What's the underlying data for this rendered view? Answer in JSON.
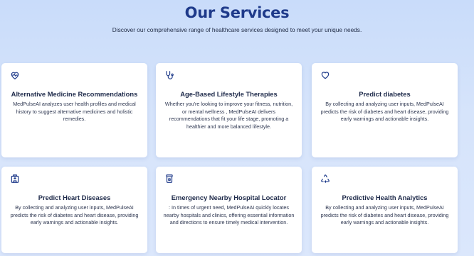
{
  "header": {
    "title": "Our Services",
    "subtitle": "Discover our comprehensive range of healthcare services designed to meet your unique needs."
  },
  "services": [
    {
      "icon": "heart-pulse-icon",
      "title": "Alternative Medicine Recommendations",
      "description": "MedPulseAI analyzes user health profiles and medical history to suggest alternative medicines and holistic remedies."
    },
    {
      "icon": "stethoscope-icon",
      "title": "Age-Based Lifestyle Therapies",
      "description": "Whether you're looking to improve your fitness, nutrition, or mental wellness , MedPulseAI delivers recommendations that fit your life stage, promoting a healthier and more balanced lifestyle."
    },
    {
      "icon": "heart-icon",
      "title": "Predict diabetes",
      "description": "By collecting and analyzing user inputs, MedPulseAI predicts the risk of diabetes and heart disease, providing early warnings and actionable insights."
    },
    {
      "icon": "hospital-building-icon",
      "title": "Predict Heart Diseases",
      "description": "By collecting and analyzing user inputs, MedPulseAI predicts the risk of diabetes and heart disease, providing early warnings and actionable insights."
    },
    {
      "icon": "pill-bottle-icon",
      "title": "Emergency Nearby Hospital Locator",
      "description": ": In times of urgent need, MedPulseAI quickly locates nearby hospitals and clinics, offering essential information and directions to ensure timely medical intervention."
    },
    {
      "icon": "recycle-icon",
      "title": "Predictive Health Analytics",
      "description": "By collecting and analyzing user inputs, MedPulseAI predicts the risk of diabetes and heart disease, providing early warnings and actionable insights."
    }
  ]
}
